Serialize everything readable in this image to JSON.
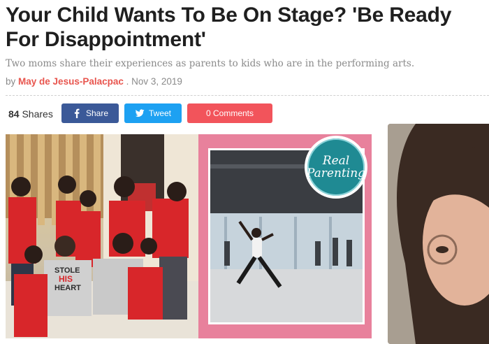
{
  "article": {
    "headline": "Your Child Wants To Be On Stage? 'Be Ready For Disappointment'",
    "subheadline": "Two moms share their experiences as parents to kids who are in the performing arts.",
    "byline_prefix": "by",
    "author": "May de Jesus-Palacpac",
    "date": ". Nov 3, 2019"
  },
  "share_bar": {
    "count": "84",
    "count_label": "Shares",
    "facebook_label": "Share",
    "twitter_label": "Tweet",
    "comments_label": "0 Comments"
  },
  "hero": {
    "badge_line1": "Real",
    "badge_line2": "Parenting",
    "shirt_text_1": "STOLE",
    "shirt_text_2": "HIS",
    "shirt_text_3": "HEART"
  },
  "colors": {
    "author": "#e8554e",
    "facebook": "#3b5998",
    "twitter": "#1da1f2",
    "comments": "#f2545b",
    "hero_frame": "#e8819c",
    "badge": "#1f8a93"
  }
}
